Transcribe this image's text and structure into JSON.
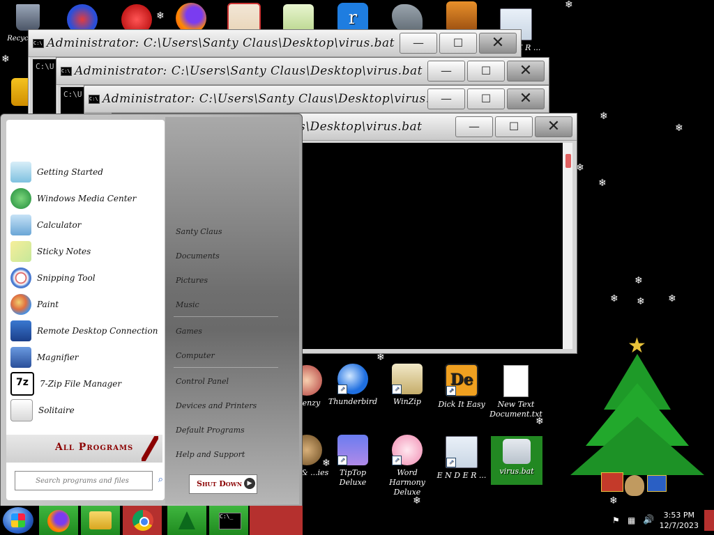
{
  "desktop": {
    "icons_top": [
      {
        "name": "recycle-bin-icon",
        "label": "Recycle Bin"
      },
      {
        "name": "app-icon-blue-9",
        "label": ""
      },
      {
        "name": "app-icon-red-creature",
        "label": ""
      },
      {
        "name": "firefox-icon",
        "label": ""
      },
      {
        "name": "shrine-gate-icon",
        "label": ""
      },
      {
        "name": "notepad-frog-icon",
        "label": ""
      },
      {
        "name": "rufus-icon",
        "label": ""
      },
      {
        "name": "shark-icon",
        "label": ""
      },
      {
        "name": "game-icon",
        "label": ""
      },
      {
        "name": "ender-top-icon",
        "label": "E N D E R ..."
      }
    ],
    "icons_mid": [
      {
        "name": "frenzy-icon",
        "label": "Frenzy"
      },
      {
        "name": "thunderbird-icon",
        "label": "Thunderbird"
      },
      {
        "name": "winzip-icon",
        "label": "WinZip"
      },
      {
        "name": "dick-it-easy-icon",
        "label": "Dick It Easy"
      },
      {
        "name": "new-text-document-icon",
        "label": "New Text Document.txt"
      }
    ],
    "icons_bottom": [
      {
        "name": "game-small-icon",
        "label": "...s, & ...ies"
      },
      {
        "name": "tiptop-deluxe-icon",
        "label": "TipTop Deluxe"
      },
      {
        "name": "word-harmony-icon",
        "label": "Word Harmony Deluxe"
      },
      {
        "name": "ender-bottom-icon",
        "label": "E N D E R ..."
      },
      {
        "name": "virus-bat-icon",
        "label": "virus.bat"
      }
    ]
  },
  "windows": {
    "title": "Administrator: C:\\Users\\Santy Claus\\Desktop\\virus.bat",
    "title_partial": "s\\Desktop\\virus.bat",
    "console_text": "C:\\U:",
    "minimize": "—",
    "maximize": "☐",
    "close": "✕"
  },
  "start_menu": {
    "programs": [
      {
        "label": "Getting Started",
        "icon": "getting-started-icon"
      },
      {
        "label": "Windows Media Center",
        "icon": "media-center-icon"
      },
      {
        "label": "Calculator",
        "icon": "calculator-icon"
      },
      {
        "label": "Sticky Notes",
        "icon": "sticky-notes-icon"
      },
      {
        "label": "Snipping Tool",
        "icon": "snipping-tool-icon"
      },
      {
        "label": "Paint",
        "icon": "paint-icon"
      },
      {
        "label": "Remote Desktop Connection",
        "icon": "remote-desktop-icon"
      },
      {
        "label": "Magnifier",
        "icon": "magnifier-icon"
      },
      {
        "label": "7-Zip File Manager",
        "icon": "seven-zip-icon"
      },
      {
        "label": "Solitaire",
        "icon": "solitaire-icon"
      }
    ],
    "places": [
      "Santy Claus",
      "Documents",
      "Pictures",
      "Music",
      "Games",
      "Computer",
      "Control Panel",
      "Devices and Printers",
      "Default Programs",
      "Help and Support"
    ],
    "all_programs": "All Programs",
    "search_placeholder": "Search programs and files",
    "shutdown": "Shut Down"
  },
  "taskbar": {
    "clock_time": "3:53 PM",
    "clock_date": "12/7/2023"
  },
  "colors": {
    "taskbar_red": "#b5302e",
    "selected_icon_green": "#2ea02e",
    "all_programs_text": "#8b0000"
  }
}
